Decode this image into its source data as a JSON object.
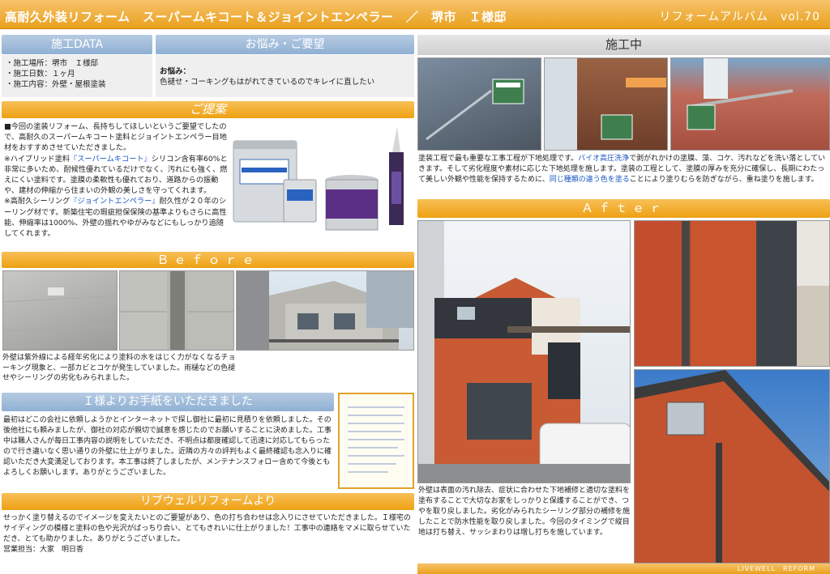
{
  "header": {
    "title": "高耐久外装リフォーム　スーパームキコート＆ジョイントエンペラー　／　堺市　Ｉ様邸",
    "album": "リフォームアルバム　vol.70"
  },
  "data_section": {
    "title": "施工DATA",
    "items": [
      "・施工場所：堺市　Ｉ様邸",
      "・施工日数：１ヶ月",
      "・施工内容：外壁・屋根塗装"
    ]
  },
  "concern_section": {
    "title": "お悩み・ご要望",
    "label": "お悩み：",
    "text": "色褪せ・コーキングもはがれてきているのでキレイに直したい"
  },
  "proposal": {
    "title": "ご提案",
    "p1": "■今回の塗装リフォーム、長持ちしてほしいというご要望でしたので、高耐久のスーパームキコート塗料とジョイントエンペラー目地材をおすすめさせていただきました。",
    "p2_a": "※ハイブリッド塗料",
    "p2_b": "『スーパームキコート』",
    "p2_c": "シリコン含有率60%と非常に多いため、耐候性優れているだけでなく、汚れにも強く、燃えにくい塗料です。塗膜の柔軟性も優れており、道路からの振動や、建材の伸縮から住まいの外観の美しさを守ってくれます。",
    "p3_a": "※高耐久シーリング",
    "p3_b": "『ジョイントエンペラー』",
    "p3_c": "耐久性が２０年のシーリング材です。新築住宅の瑕疵担保保険の基準よりもさらに高性能、伸縮率は1000%、外壁の揺れやゆがみなどにもしっかり追随してくれます。"
  },
  "before": {
    "title": "Ｂｅｆｏｒｅ",
    "caption": "外壁は紫外線による経年劣化により塗料の水をはじく力がなくなるチョーキング現象と、一部カビとコケが発生していました。雨樋などの色褪せやシーリングの劣化もみられました。"
  },
  "letter_section": {
    "title": "Ｉ様よりお手紙をいただきました",
    "text": "最初はどこの会社に依頼しようかとインターネットで探し御社に最初に見積りを依頼しました。その後他社にも頼みましたが、御社の対応が親切で誠意を感じたのでお願いすることに決めました。工事中は職人さんが毎日工事内容の説明をしていただき、不明点は都度確認して迅速に対応してもらったので行き違いなく思い通りの外壁に仕上がりました。近隣の方々の評判もよく最終確認も念入りに確認いただき大変満足しております。本工事は終了しましたが、メンテナンスフォロー含めて今後ともよろしくお願いします。ありがとうございました。"
  },
  "message_section": {
    "title": "リブウェルリフォームより",
    "text": "せっかく塗り替えるのでイメージを変えたいとのご要望があり、色の打ち合わせは念入りにさせていただきました。Ｉ様宅のサイディングの模様と塗料の色や光沢がばっちり合い、とてもきれいに仕上がりました！工事中の連絡をマメに取らせていただき、とても助かりました。ありがとうございました。",
    "staff": "営業担当：大家　明日香"
  },
  "construction": {
    "title": "施工中",
    "t1": "塗装工程で最も重要な工事工程が下地処理です。",
    "t2": "バイオ高圧洗浄",
    "t3": "で剥がれかけの塗膜、藻、コケ、汚れなどを洗い落としていきます。そして劣化程度や素材に応じた下地処理を施します。塗装の工程として、塗膜の厚みを充分に確保し、長期にわたって美しい外観や性能を保持するために、",
    "t4": "同じ種類の違う色を塗る",
    "t5": "ことにより塗りむらを防ぎながら、重ね塗りを施します。"
  },
  "after": {
    "title": "Ａｆｔｅｒ",
    "caption": "外壁は表面の汚れ除去、症状に合わせた下地補修と適切な塗料を塗布することで大切なお家をしっかりと保護することができ、つやを取り戻しました。劣化がみられたシーリング部分の補修を施したことで防水性能を取り戻しました。今回のタイミングで縦目地は打ち替え、サッシまわりは増し打ちを施しています。"
  },
  "footer": "LIVEWELL　REFORM"
}
